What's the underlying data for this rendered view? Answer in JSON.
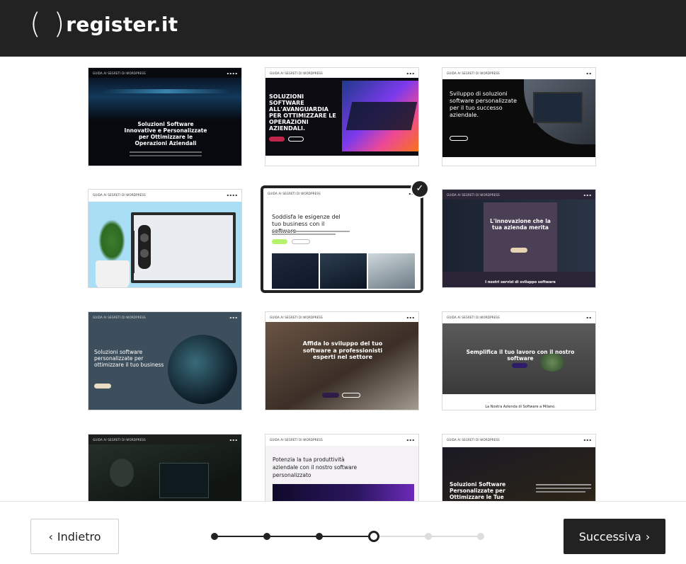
{
  "header": {
    "logo_open": "(",
    "logo_close": ")",
    "logo_word": "register.it"
  },
  "templates": [
    {
      "name": "template-1",
      "brand": "GUIDA AI SEGRETI DI WORDPRESS",
      "links": "▪ ▪ ▪ ▪",
      "title": "Soluzioni Software Innovative e Personalizzate per Ottimizzare le Operazioni Aziendali",
      "selected": false
    },
    {
      "name": "template-2",
      "brand": "GUIDA AI SEGRETI DI WORDPRESS",
      "links": "▪ ▪ ▪",
      "title": "SOLUZIONI SOFTWARE ALL'AVANGUARDIA PER OTTIMIZZARE LE OPERAZIONI AZIENDALI.",
      "selected": false
    },
    {
      "name": "template-3",
      "brand": "GUIDA AI SEGRETI DI WORDPRESS",
      "links": "▪ ▪",
      "title": "Sviluppo di soluzioni software personalizzate per il tuo successo aziendale.",
      "selected": false
    },
    {
      "name": "template-4",
      "brand": "GUIDA AI SEGRETI DI WORDPRESS",
      "links": "▪ ▪ ▪ ▪",
      "title": "",
      "selected": false
    },
    {
      "name": "template-5",
      "brand": "GUIDA AI SEGRETI DI WORDPRESS",
      "links": "▪ ▪ ▪",
      "title": "Soddisfa le esigenze del tuo business con il software",
      "selected": true
    },
    {
      "name": "template-6",
      "brand": "GUIDA AI SEGRETI DI WORDPRESS",
      "links": "▪ ▪ ▪",
      "title": "L'innovazione che la tua azienda merita",
      "footer_text": "I nostri servizi di sviluppo software",
      "selected": false
    },
    {
      "name": "template-7",
      "brand": "GUIDA AI SEGRETI DI WORDPRESS",
      "links": "▪ ▪ ▪",
      "title": "Soluzioni software personalizzate per ottimizzare il tuo business",
      "selected": false
    },
    {
      "name": "template-8",
      "brand": "GUIDA AI SEGRETI DI WORDPRESS",
      "links": "▪ ▪ ▪",
      "title": "Affida lo sviluppo del tuo software a professionisti esperti nel settore",
      "selected": false
    },
    {
      "name": "template-9",
      "brand": "GUIDA AI SEGRETI DI WORDPRESS",
      "links": "▪ ▪",
      "title": "Semplifica il tuo lavoro con il nostro software",
      "footer_text": "La Nostra Azienda di Software a Milano.",
      "selected": false
    },
    {
      "name": "template-10",
      "brand": "GUIDA AI SEGRETI DI WORDPRESS",
      "links": "▪ ▪ ▪",
      "title": "",
      "selected": false
    },
    {
      "name": "template-11",
      "brand": "GUIDA AI SEGRETI DI WORDPRESS",
      "links": "▪ ▪ ▪",
      "title": "Potenzia la tua produttività aziendale con il nostro software personalizzato",
      "selected": false
    },
    {
      "name": "template-12",
      "brand": "GUIDA AI SEGRETI DI WORDPRESS",
      "links": "▪ ▪ ▪",
      "title": "Soluzioni Software Personalizzate per Ottimizzare le Tue Operazioni",
      "selected": false
    }
  ],
  "footer": {
    "back_label": "Indietro",
    "next_label": "Successiva",
    "back_icon": "chevron-left-icon",
    "next_icon": "chevron-right-icon"
  },
  "stepper": {
    "total_steps": 6,
    "current_step": 4
  },
  "colors": {
    "dark": "#222222",
    "accent_green": "#b7f36a",
    "light_gray": "#dddddd"
  }
}
